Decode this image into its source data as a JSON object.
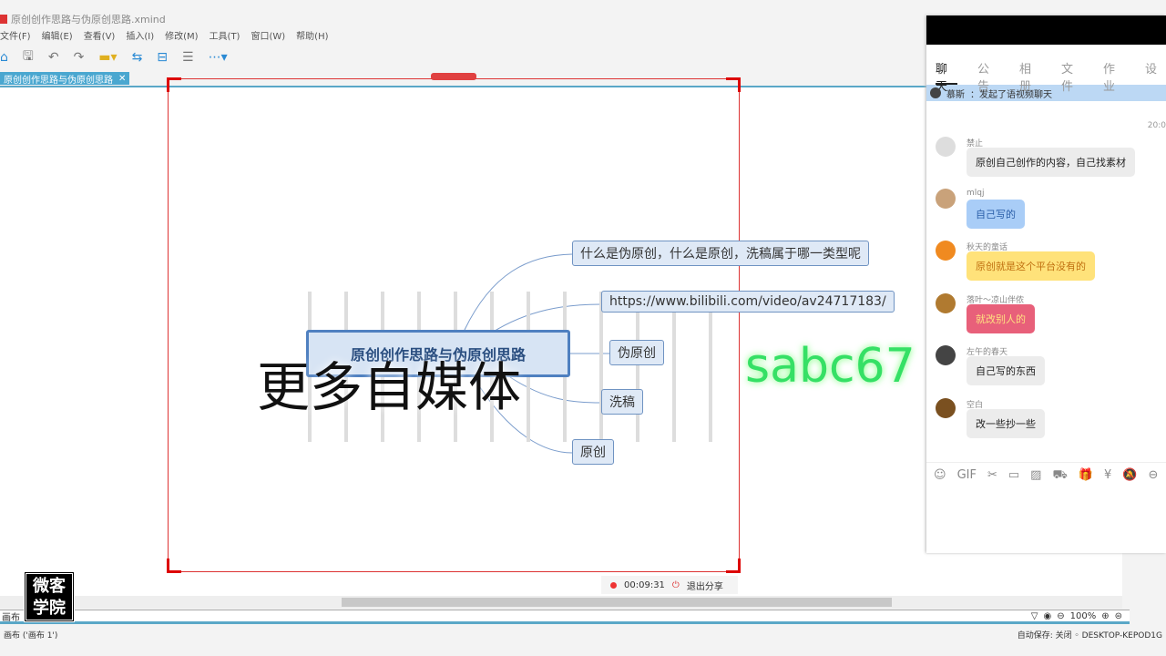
{
  "window": {
    "title": "原创创作思路与伪原创思路.xmind"
  },
  "menu": [
    "文件(F)",
    "编辑(E)",
    "查看(V)",
    "插入(I)",
    "修改(M)",
    "工具(T)",
    "窗口(W)",
    "帮助(H)"
  ],
  "doc_tab": {
    "label": "原创创作思路与伪原创思路",
    "close": "✕"
  },
  "mindmap": {
    "root": "原创创作思路与伪原创思路",
    "topics": [
      "什么是伪原创，什么是原创，洗稿属于哪一类型呢",
      "https://www.bilibili.com/video/av24717183/",
      "伪原创",
      "洗稿",
      "原创"
    ]
  },
  "watermarks": {
    "left": "更多自媒体",
    "right": "sabc67"
  },
  "recording": {
    "time": "00:09:31",
    "stop": "退出分享"
  },
  "status": {
    "sheet": "画布 1",
    "sheet_info": "画布 ('画布 1')",
    "zoom": "100%",
    "autosave": "自动保存: 关闭",
    "computer": "DESKTOP-KEPOD1G"
  },
  "logo": {
    "line1": "微客",
    "line2": "学院"
  },
  "chat": {
    "tabs": [
      "聊天",
      "公告",
      "相册",
      "文件",
      "作业",
      "设"
    ],
    "notice": {
      "user": "慕斯",
      "text": "：发起了语视频聊天"
    },
    "time": "20:0",
    "messages": [
      {
        "name": "禁止",
        "text": "原创自己创作的内容，自己找素材",
        "bg": "#ececec",
        "color": "#222",
        "avatar": "#ddd"
      },
      {
        "name": "mlqj",
        "text": "自己写的",
        "bg": "#a9cdf7",
        "color": "#2a5ea8",
        "avatar": "#c9a27a"
      },
      {
        "name": "秋天的童话",
        "text": "原创就是这个平台没有的",
        "bg": "#ffe27a",
        "color": "#c07010",
        "avatar": "#f08a20"
      },
      {
        "name": "落叶～凉山伴侬",
        "text": "就改别人的",
        "bg": "#e8607a",
        "color": "#ffe080",
        "avatar": "#b07a30"
      },
      {
        "name": "左午的春天",
        "text": "自己写的东西",
        "bg": "#ececec",
        "color": "#222",
        "avatar": "#444"
      },
      {
        "name": "空白",
        "text": "改一些抄一些",
        "bg": "#ececec",
        "color": "#222",
        "avatar": "#7a5020"
      }
    ],
    "tools": [
      "☺",
      "GIF",
      "✂",
      "▭",
      "▨",
      "⛟",
      "🎁",
      "¥",
      "🔕",
      "⊖"
    ]
  }
}
